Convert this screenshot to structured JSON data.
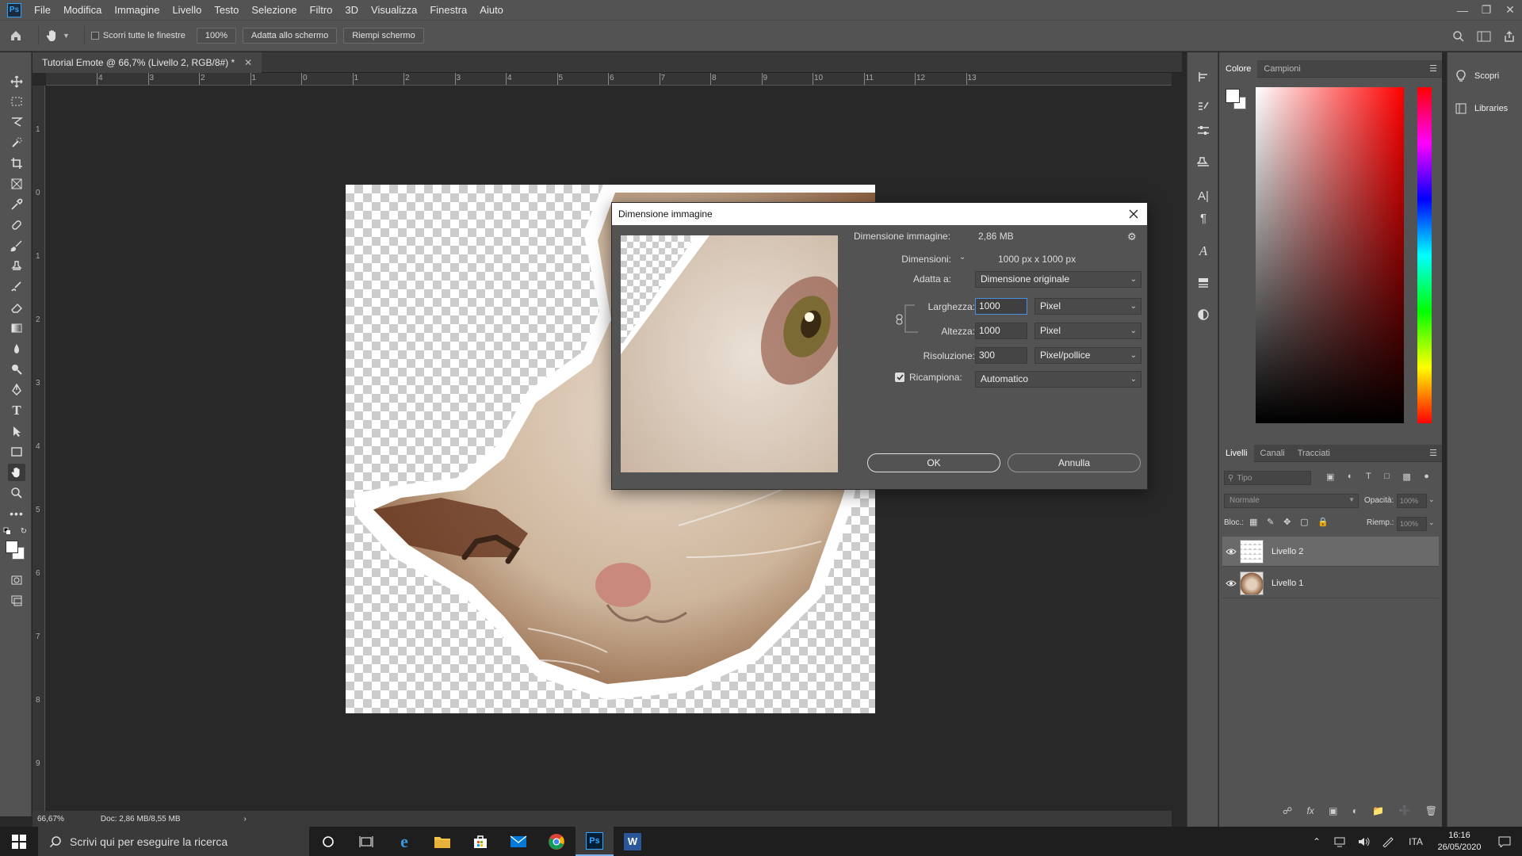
{
  "menubar": {
    "logo": "Ps",
    "items": [
      "File",
      "Modifica",
      "Immagine",
      "Livello",
      "Testo",
      "Selezione",
      "Filtro",
      "3D",
      "Visualizza",
      "Finestra",
      "Aiuto"
    ]
  },
  "options": {
    "scroll_all_label": "Scorri tutte le finestre",
    "zoom_btn": "100%",
    "fit_btn": "Adatta allo schermo",
    "fill_btn": "Riempi schermo"
  },
  "document": {
    "tab_title": "Tutorial Emote @ 66,7% (Livello 2, RGB/8#) *",
    "ruler_h": [
      "4",
      "3",
      "2",
      "1",
      "0",
      "1",
      "2",
      "3",
      "4",
      "5",
      "6",
      "7",
      "8",
      "9",
      "10",
      "11",
      "12",
      "13"
    ],
    "ruler_v": [
      "1",
      "0",
      "1",
      "2",
      "3",
      "4",
      "5",
      "6",
      "7",
      "8",
      "9"
    ]
  },
  "status": {
    "zoom": "66,67%",
    "doc": "Doc: 2,86 MB/8,55 MB"
  },
  "color_panel": {
    "tabs": [
      "Colore",
      "Campioni"
    ]
  },
  "layers_panel": {
    "tabs": [
      "Livelli",
      "Canali",
      "Tracciati"
    ],
    "search_placeholder": "Tipo",
    "blend_mode": "Normale",
    "opacity_label": "Opacità:",
    "opacity_value": "100%",
    "lock_label": "Bloc.:",
    "fill_label": "Riemp.:",
    "fill_value": "100%",
    "layers": [
      {
        "name": "Livello 2",
        "selected": true
      },
      {
        "name": "Livello 1",
        "selected": false
      }
    ]
  },
  "far_panel": {
    "discover": "Scopri",
    "libraries": "Libraries"
  },
  "dialog": {
    "title": "Dimensione immagine",
    "size_label": "Dimensione immagine:",
    "size_value": "2,86 MB",
    "dims_label": "Dimensioni:",
    "dims_value": "1000 px  x  1000 px",
    "fit_label": "Adatta a:",
    "fit_value": "Dimensione originale",
    "width_label": "Larghezza:",
    "width_value": "1000",
    "width_unit": "Pixel",
    "height_label": "Altezza:",
    "height_value": "1000",
    "height_unit": "Pixel",
    "res_label": "Risoluzione:",
    "res_value": "300",
    "res_unit": "Pixel/pollice",
    "resample_label": "Ricampiona:",
    "resample_value": "Automatico",
    "ok": "OK",
    "cancel": "Annulla"
  },
  "taskbar": {
    "search_placeholder": "Scrivi qui per eseguire la ricerca",
    "lang": "ITA",
    "time": "16:16",
    "date": "26/05/2020"
  }
}
